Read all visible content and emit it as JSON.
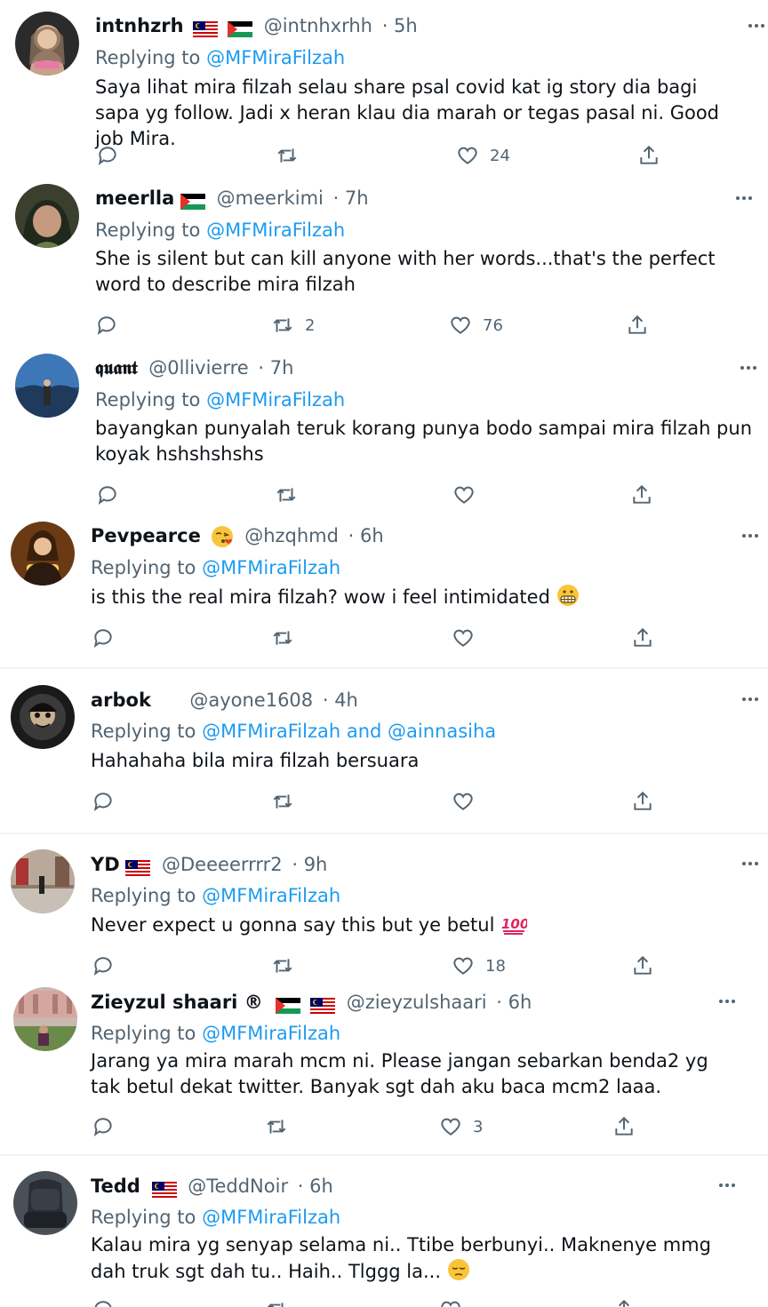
{
  "tweets": [
    {
      "name": "intnhzrh",
      "handle": "@intnhxrhh",
      "time": "· 5h",
      "replying_prefix": "Replying to",
      "mentions": "@MFMiraFilzah",
      "body": "Saya lihat mira filzah selau share psal covid kat ig story dia bagi sapa yg follow. Jadi x heran klau dia marah or tegas pasal ni.  Good job Mira.",
      "retweets": "",
      "likes": "24"
    },
    {
      "name": "meerlla",
      "handle": "@meerkimi",
      "time": "· 7h",
      "replying_prefix": "Replying to",
      "mentions": "@MFMiraFilzah",
      "body": "She is silent but can kill anyone with her words...that's the perfect word to describe mira filzah",
      "retweets": "2",
      "likes": "76"
    },
    {
      "name": "𝖖𝖚𝖆𝖓𝖙",
      "handle": "@0llivierre",
      "time": "· 7h",
      "replying_prefix": "Replying to",
      "mentions": "@MFMiraFilzah",
      "body": "bayangkan punyalah teruk korang punya bodo sampai mira filzah pun koyak hshshshshs",
      "retweets": "",
      "likes": ""
    },
    {
      "name": "Pevpearce",
      "handle": "@hzqhmd",
      "time": "· 6h",
      "replying_prefix": "Replying to",
      "mentions": "@MFMiraFilzah",
      "body": "is this the real mira filzah? wow i feel intimidated",
      "retweets": "",
      "likes": ""
    },
    {
      "name": "arbok",
      "handle": "@ayone1608",
      "time": "· 4h",
      "replying_prefix": "Replying to",
      "mentions": "@MFMiraFilzah and @ainnasiha",
      "body": "Hahahaha bila mira filzah bersuara",
      "retweets": "",
      "likes": ""
    },
    {
      "name": "YD",
      "handle": "@Deeeerrrr2",
      "time": "· 9h",
      "replying_prefix": "Replying to",
      "mentions": "@MFMiraFilzah",
      "body": "Never expect u gonna say this but ye betul",
      "retweets": "",
      "likes": "18"
    },
    {
      "name": "Zieyzul shaari ®",
      "handle": "@zieyzulshaari",
      "time": "· 6h",
      "replying_prefix": "Replying to",
      "mentions": "@MFMiraFilzah",
      "body": "Jarang ya mira marah mcm ni. Please jangan sebarkan benda2 yg tak betul dekat twitter. Banyak sgt dah aku baca mcm2 laaa.",
      "retweets": "",
      "likes": "3"
    },
    {
      "name": "Tedd",
      "handle": "@TeddNoir",
      "time": "· 6h",
      "replying_prefix": "Replying to",
      "mentions": "@MFMiraFilzah",
      "body": "Kalau mira yg senyap selama ni.. Ttibe berbunyi.. Maknenye mmg dah truk sgt dah tu.. Haih.. Tlggg la...",
      "retweets": "",
      "likes": ""
    }
  ],
  "icons": {
    "reply": "speech-bubble",
    "retweet": "retweet-arrows",
    "like": "heart",
    "share": "upload-arrow",
    "more": "three-dots"
  },
  "colors": {
    "accent": "#1d9bf0",
    "secondary": "#536471",
    "text": "#0f1419",
    "divider": "#eff3f4"
  }
}
